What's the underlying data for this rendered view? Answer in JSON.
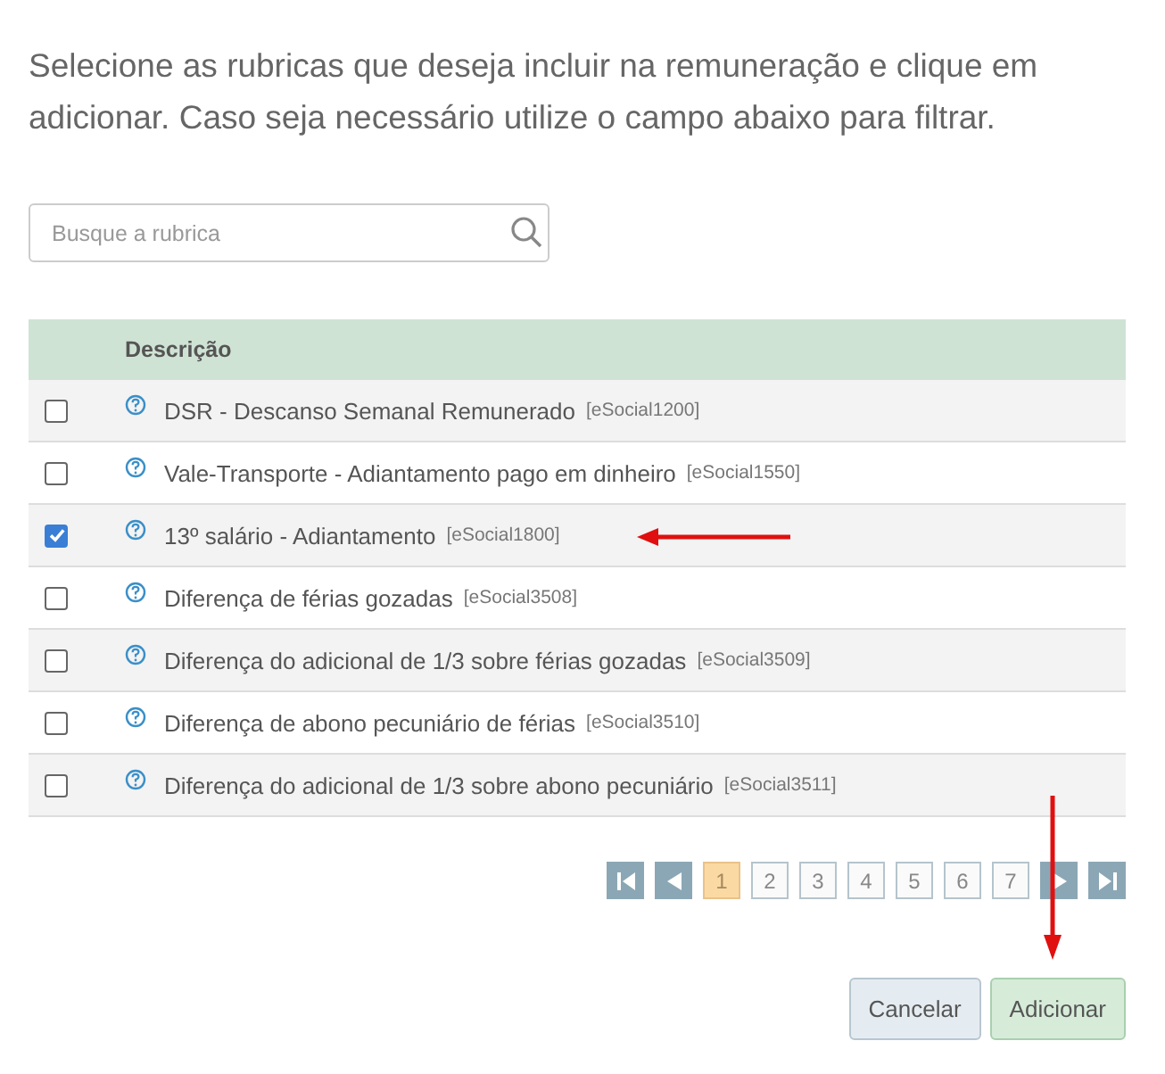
{
  "intro": "Selecione as rubricas que deseja incluir na remuneração e clique em adicionar. Caso seja necessário utilize o campo abaixo para filtrar.",
  "search": {
    "placeholder": "Busque a rubrica"
  },
  "table": {
    "columns": [
      "Descrição"
    ],
    "rows": [
      {
        "name": "DSR - Descanso Semanal Remunerado",
        "code": "[eSocial1200]",
        "checked": false
      },
      {
        "name": "Vale-Transporte - Adiantamento pago em dinheiro",
        "code": "[eSocial1550]",
        "checked": false
      },
      {
        "name": "13º salário - Adiantamento",
        "code": "[eSocial1800]",
        "checked": true
      },
      {
        "name": "Diferença de férias gozadas",
        "code": "[eSocial3508]",
        "checked": false
      },
      {
        "name": "Diferença do adicional de 1/3 sobre férias gozadas",
        "code": "[eSocial3509]",
        "checked": false
      },
      {
        "name": "Diferença de abono pecuniário de férias",
        "code": "[eSocial3510]",
        "checked": false
      },
      {
        "name": "Diferença do adicional de 1/3 sobre abono pecuniário",
        "code": "[eSocial3511]",
        "checked": false
      }
    ]
  },
  "pagination": {
    "pages": [
      {
        "label": "1",
        "selected": true
      },
      {
        "label": "2",
        "selected": false
      },
      {
        "label": "3",
        "selected": false
      },
      {
        "label": "4",
        "selected": false
      },
      {
        "label": "5",
        "selected": false
      },
      {
        "label": "6",
        "selected": false
      },
      {
        "label": "7",
        "selected": false
      }
    ]
  },
  "buttons": [
    {
      "label": "Cancelar",
      "kind": "secondary"
    },
    {
      "label": "Adicionar",
      "kind": "primary"
    }
  ]
}
